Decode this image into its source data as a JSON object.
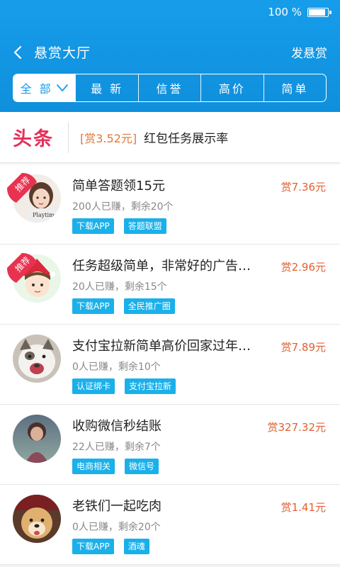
{
  "status": {
    "battery_text": "100 %"
  },
  "nav": {
    "title": "悬赏大厅",
    "publish_label": "发悬赏"
  },
  "tabs": [
    {
      "label": "全 部",
      "active": true
    },
    {
      "label": "最 新",
      "active": false
    },
    {
      "label": "信誉",
      "active": false
    },
    {
      "label": "高价",
      "active": false
    },
    {
      "label": "简单",
      "active": false
    }
  ],
  "headline": {
    "badge": "头条",
    "reward": "[赏3.52元]",
    "text": "红包任务展示率"
  },
  "items": [
    {
      "title": "简单答题领15元",
      "price": "赏7.36元",
      "meta": "200人已赚，剩余20个",
      "tags": [
        "下载APP",
        "答题联盟"
      ],
      "recommend": "推荐",
      "avatar": "girl-photo"
    },
    {
      "title": "任务超级简单，非常好的广告…",
      "price": "赏2.96元",
      "meta": "20人已赚，剩余15个",
      "tags": [
        "下载APP",
        "全民推广圈"
      ],
      "recommend": "推荐",
      "avatar": "anime-boy"
    },
    {
      "title": "支付宝拉新简单高价回家过年…",
      "price": "赏7.89元",
      "meta": "0人已赚，剩余10个",
      "tags": [
        "认证绑卡",
        "支付宝拉新"
      ],
      "recommend": "",
      "avatar": "cat-photo"
    },
    {
      "title": "收购微信秒结账",
      "price": "赏327.32元",
      "meta": "22人已赚，剩余7个",
      "tags": [
        "电商相关",
        "微信号"
      ],
      "recommend": "",
      "avatar": "person-photo"
    },
    {
      "title": "老铁们一起吃肉",
      "price": "赏1.41元",
      "meta": "0人已赚，剩余20个",
      "tags": [
        "下载APP",
        "酒魂"
      ],
      "recommend": "",
      "avatar": "dog-photo"
    }
  ],
  "colors": {
    "header": "#169dea",
    "badge": "#e72f5a",
    "price": "#e06030",
    "tag": "#1ab0ea"
  }
}
